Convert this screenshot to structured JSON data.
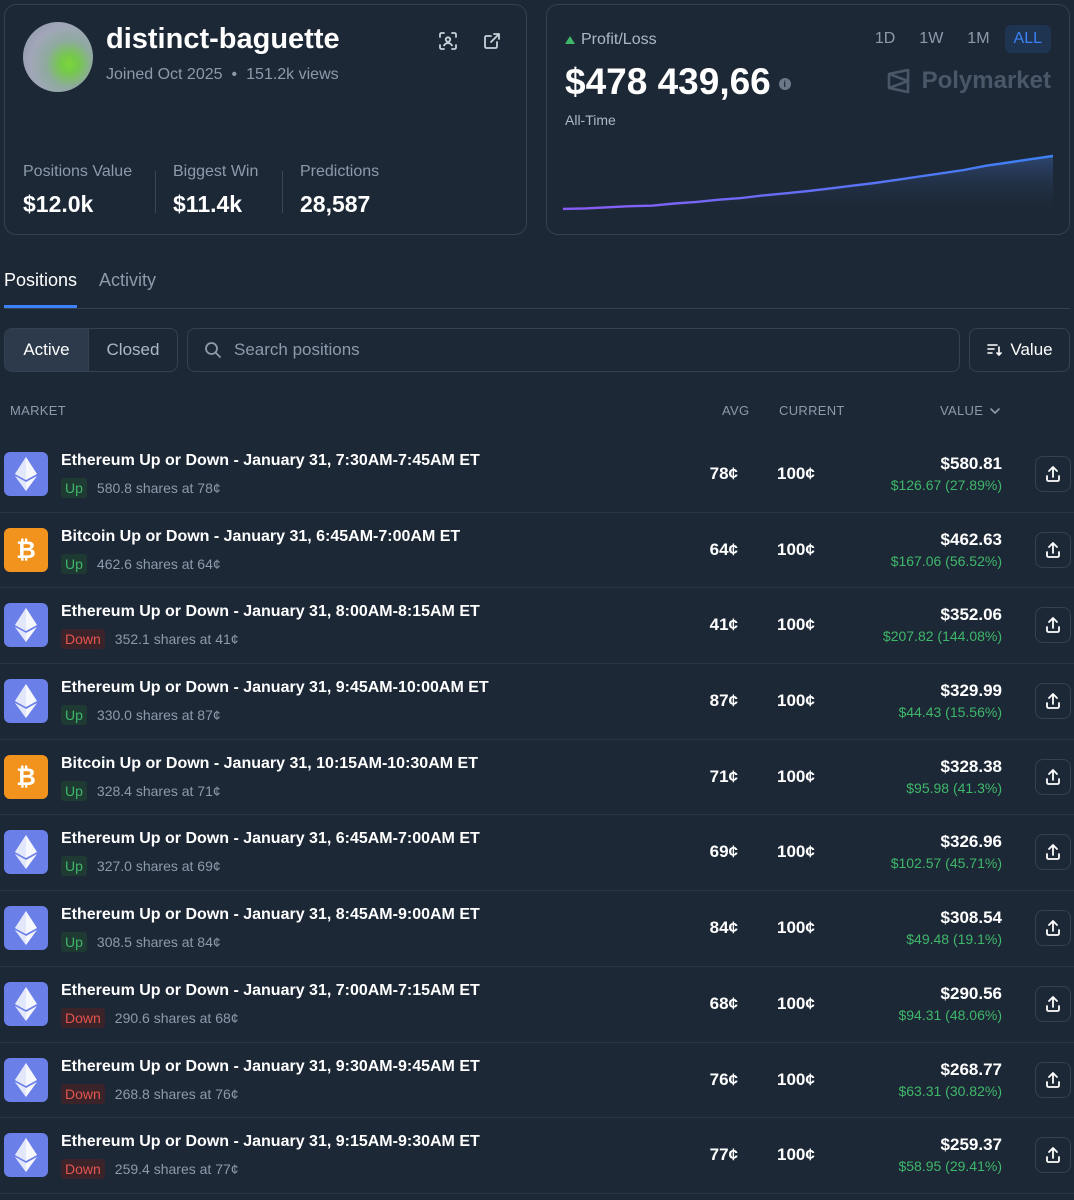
{
  "profile": {
    "username": "distinct-baguette",
    "joined": "Joined Oct 2025",
    "views": "151.2k views",
    "stats": [
      {
        "label": "Positions Value",
        "value": "$12.0k"
      },
      {
        "label": "Biggest Win",
        "value": "$11.4k"
      },
      {
        "label": "Predictions",
        "value": "28,587"
      }
    ]
  },
  "pnl": {
    "label": "Profit/Loss",
    "amount": "$478 439,66",
    "period": "All-Time",
    "ranges": [
      "1D",
      "1W",
      "1M",
      "ALL"
    ],
    "active_range": "ALL",
    "brand": "Polymarket",
    "trend_points": [
      0.02,
      0.03,
      0.05,
      0.07,
      0.08,
      0.12,
      0.15,
      0.19,
      0.22,
      0.27,
      0.31,
      0.35,
      0.4,
      0.45,
      0.5,
      0.56,
      0.62,
      0.68,
      0.74,
      0.82,
      0.88,
      0.94,
      1.0
    ],
    "accent": "#3fb76a"
  },
  "tabs": [
    "Positions",
    "Activity"
  ],
  "filters": {
    "active": "Active",
    "closed": "Closed"
  },
  "search": {
    "placeholder": "Search positions"
  },
  "sort": {
    "label": "Value"
  },
  "columns": {
    "market": "MARKET",
    "avg": "AVG",
    "current": "CURRENT",
    "value": "VALUE"
  },
  "positions": [
    {
      "coin": "eth",
      "title": "Ethereum Up or Down - January 31, 7:30AM-7:45AM ET",
      "side": "Up",
      "shares": "580.8 shares at 78¢",
      "avg": "78¢",
      "current": "100¢",
      "value": "$580.81",
      "pnl": "$126.67 (27.89%)"
    },
    {
      "coin": "btc",
      "title": "Bitcoin Up or Down - January 31, 6:45AM-7:00AM ET",
      "side": "Up",
      "shares": "462.6 shares at 64¢",
      "avg": "64¢",
      "current": "100¢",
      "value": "$462.63",
      "pnl": "$167.06 (56.52%)"
    },
    {
      "coin": "eth",
      "title": "Ethereum Up or Down - January 31, 8:00AM-8:15AM ET",
      "side": "Down",
      "shares": "352.1 shares at 41¢",
      "avg": "41¢",
      "current": "100¢",
      "value": "$352.06",
      "pnl": "$207.82 (144.08%)"
    },
    {
      "coin": "eth",
      "title": "Ethereum Up or Down - January 31, 9:45AM-10:00AM ET",
      "side": "Up",
      "shares": "330.0 shares at 87¢",
      "avg": "87¢",
      "current": "100¢",
      "value": "$329.99",
      "pnl": "$44.43 (15.56%)"
    },
    {
      "coin": "btc",
      "title": "Bitcoin Up or Down - January 31, 10:15AM-10:30AM ET",
      "side": "Up",
      "shares": "328.4 shares at 71¢",
      "avg": "71¢",
      "current": "100¢",
      "value": "$328.38",
      "pnl": "$95.98 (41.3%)"
    },
    {
      "coin": "eth",
      "title": "Ethereum Up or Down - January 31, 6:45AM-7:00AM ET",
      "side": "Up",
      "shares": "327.0 shares at 69¢",
      "avg": "69¢",
      "current": "100¢",
      "value": "$326.96",
      "pnl": "$102.57 (45.71%)"
    },
    {
      "coin": "eth",
      "title": "Ethereum Up or Down - January 31, 8:45AM-9:00AM ET",
      "side": "Up",
      "shares": "308.5 shares at 84¢",
      "avg": "84¢",
      "current": "100¢",
      "value": "$308.54",
      "pnl": "$49.48 (19.1%)"
    },
    {
      "coin": "eth",
      "title": "Ethereum Up or Down - January 31, 7:00AM-7:15AM ET",
      "side": "Down",
      "shares": "290.6 shares at 68¢",
      "avg": "68¢",
      "current": "100¢",
      "value": "$290.56",
      "pnl": "$94.31 (48.06%)"
    },
    {
      "coin": "eth",
      "title": "Ethereum Up or Down - January 31, 9:30AM-9:45AM ET",
      "side": "Down",
      "shares": "268.8 shares at 76¢",
      "avg": "76¢",
      "current": "100¢",
      "value": "$268.77",
      "pnl": "$63.31 (30.82%)"
    },
    {
      "coin": "eth",
      "title": "Ethereum Up or Down - January 31, 9:15AM-9:30AM ET",
      "side": "Down",
      "shares": "259.4 shares at 77¢",
      "avg": "77¢",
      "current": "100¢",
      "value": "$259.37",
      "pnl": "$58.95 (29.41%)"
    }
  ]
}
